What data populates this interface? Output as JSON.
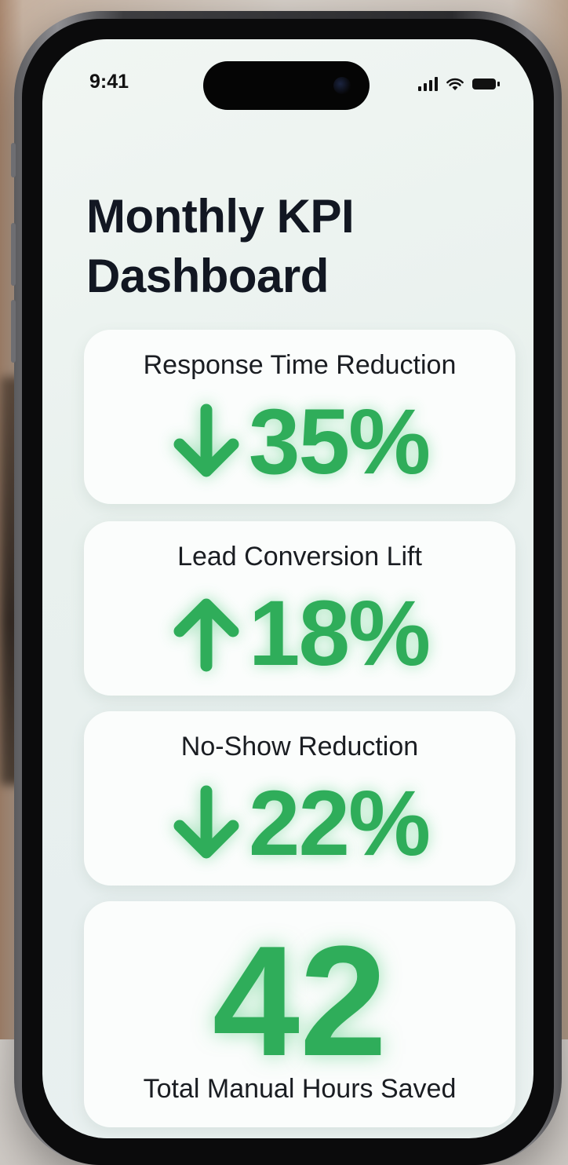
{
  "status_bar": {
    "time": "9:41"
  },
  "dashboard": {
    "title": "Monthly KPI Dashboard",
    "accent_color": "#2fad5a",
    "cards": [
      {
        "label": "Response Time Reduction",
        "value": "35%",
        "trend": "down",
        "icon": "arrow-down-icon"
      },
      {
        "label": "Lead Conversion Lift",
        "value": "18%",
        "trend": "up",
        "icon": "arrow-up-icon"
      },
      {
        "label": "No-Show Reduction",
        "value": "22%",
        "trend": "down",
        "icon": "arrow-down-icon"
      }
    ],
    "summary": {
      "value": "42",
      "label": "Total Manual Hours Saved"
    }
  }
}
